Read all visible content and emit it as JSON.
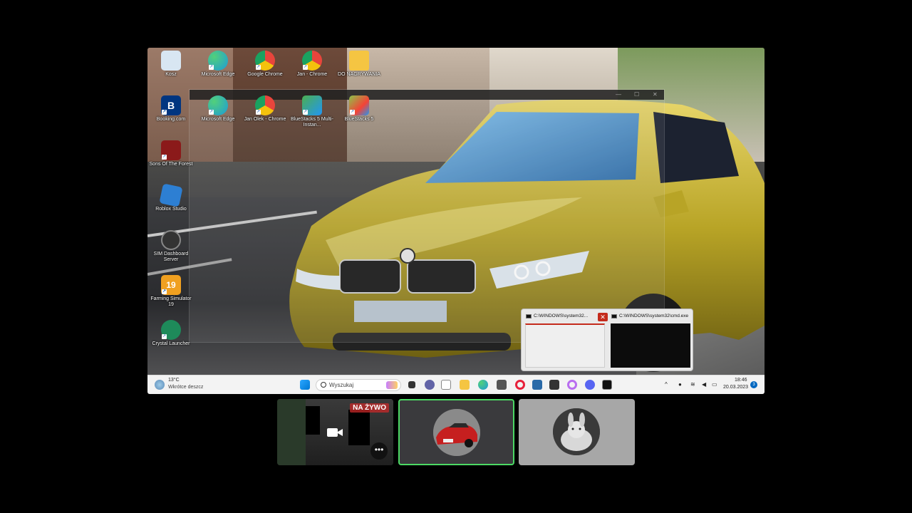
{
  "desktop_icons": [
    {
      "label": "Kosz",
      "icon": "recycle-bin-icon",
      "color": "#d8e6f2"
    },
    {
      "label": "Microsoft Edge",
      "icon": "edge-icon",
      "color": "#1d9bd8"
    },
    {
      "label": "Google Chrome",
      "icon": "chrome-icon",
      "color": "#e8453c"
    },
    {
      "label": "Jan - Chrome",
      "icon": "chrome-profile-icon",
      "color": "#e8453c"
    },
    {
      "label": "DO NAGRYWANIA",
      "icon": "folder-icon",
      "color": "#f5c542"
    },
    {
      "label": "Booking.com",
      "icon": "booking-icon",
      "color": "#003580"
    },
    {
      "label": "Microsoft Edge",
      "icon": "edge-icon",
      "color": "#1d9bd8"
    },
    {
      "label": "Jan Olek - Chrome",
      "icon": "chrome-profile-icon",
      "color": "#e8453c"
    },
    {
      "label": "BlueStacks 5 Multi-Instan...",
      "icon": "bluestacks-multi-icon",
      "color": "#4caf50"
    },
    {
      "label": "BlueStacks 5",
      "icon": "bluestacks-icon",
      "color": "#8bc34a"
    },
    {
      "label": "Sons Of The Forest",
      "icon": "sons-of-the-forest-icon",
      "color": "#8b1a1a"
    },
    {
      "label": "Roblox Studio",
      "icon": "roblox-studio-icon",
      "color": "#2d7fd3"
    },
    {
      "label": "SIM Dashboard Server",
      "icon": "sim-dashboard-icon",
      "color": "#333333"
    },
    {
      "label": "Farming Simulator 19",
      "icon": "farming-simulator-icon",
      "color": "#f0a020"
    },
    {
      "label": "Crystal Launcher",
      "icon": "crystal-launcher-icon",
      "color": "#1e8a5a"
    }
  ],
  "cmd_previews": [
    {
      "title": "C:\\WINDOWS\\system32...",
      "theme": "light"
    },
    {
      "title": "C:\\WINDOWS\\system32\\cmd.exe",
      "theme": "dark"
    }
  ],
  "taskbar": {
    "weather_temp": "13°C",
    "weather_text": "Wkrótce deszcz",
    "search_placeholder": "Wyszukaj",
    "time": "18:46",
    "date": "20.03.2023",
    "notification_count": "3"
  },
  "tiles": {
    "live_badge": "NA ŻYWO",
    "more_label": "•••"
  },
  "colors": {
    "active_speaker_border": "#4cd964",
    "live_badge": "#c82828"
  }
}
